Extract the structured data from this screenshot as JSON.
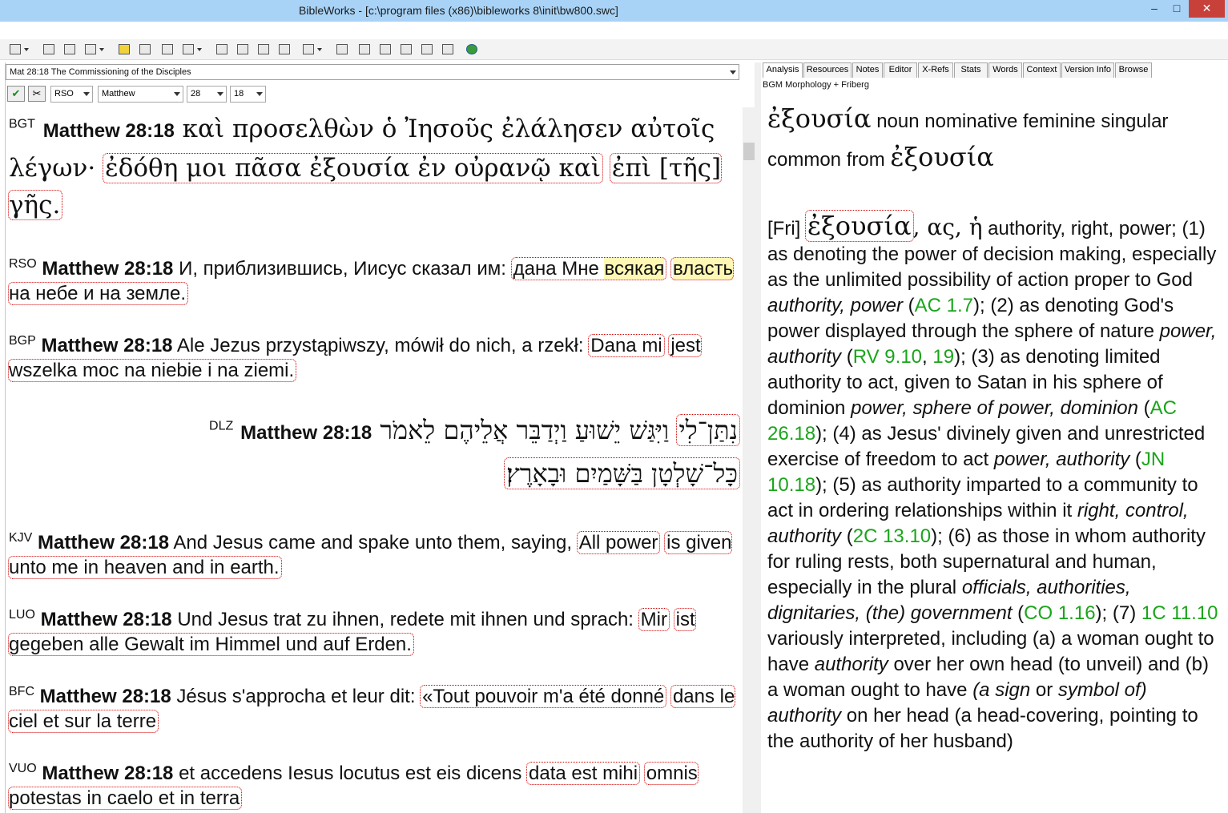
{
  "window": {
    "title": "BibleWorks - [c:\\program files (x86)\\bibleworks 8\\init\\bw800.swc]",
    "minimize": "–",
    "maximize": "□",
    "close": "✕"
  },
  "toolbar": {
    "icons": [
      "bookmark-icon",
      "new-window-icon",
      "tools-icon",
      "search-icon",
      "highlight-icon",
      "window-icon",
      "arrows-icon",
      "grid-icon",
      "list-icon",
      "copy-icon",
      "edit-icon",
      "print-icon",
      "search-options-icon",
      "layout-icon",
      "chart-icon",
      "person-icon",
      "plus-verse-icon",
      "ev-icon",
      "ew-icon",
      "globe-icon"
    ]
  },
  "left": {
    "verse_bar": "Mat 28:18 The Commissioning of the Disciples",
    "version_combo": "RSO",
    "book_combo": "Matthew",
    "chapter_combo": "28",
    "verse_combo": "18",
    "verses": [
      {
        "version": "BGT",
        "ref": "Matthew 28:18",
        "text_a": "καὶ προσελθὼν ὁ Ἰησοῦς ἐλάλησεν αὐτοῖς λέγων·",
        "text_b": "ἐδόθη μοι πᾶσα ἐξουσία ἐν οὐρανῷ καὶ",
        "text_c": "ἐπὶ [τῆς] γῆς."
      },
      {
        "version": "RSO",
        "ref": "Matthew 28:18",
        "text_a": "И, приблизившись, Иисус сказал им:",
        "text_b": "дана Мне",
        "text_y": "всякая",
        "text_c": "власть",
        "text_d": "на небе и на земле."
      },
      {
        "version": "BGP",
        "ref": "Matthew 28:18",
        "text_a": "Ale Jezus przystąpiwszy, mówił do nich, a rzekł:",
        "text_b": "Dana mi",
        "text_c": "jest wszelka moc na niebie i na ziemi."
      },
      {
        "version": "DLZ",
        "ref": "Matthew 28:18",
        "text_a": "וַיִּגַּשׁ יֵשׁוּעַ וַיְדַבֵּר אֲלֵיהֶם לֵאמֹר",
        "text_b": "נִתַּן־לִי",
        "text_c": "כָּל־שָׁלְטָן בַּשָּׁמַיִם וּבָאָרֶץ׃"
      },
      {
        "version": "KJV",
        "ref": "Matthew 28:18",
        "text_a": "And Jesus came and spake unto them, saying,",
        "text_b": "All power",
        "text_c": "is given unto me in heaven and in earth."
      },
      {
        "version": "LUO",
        "ref": "Matthew 28:18",
        "text_a": "Und Jesus trat zu ihnen, redete mit ihnen und sprach:",
        "text_b": "Mir",
        "text_c": "ist gegeben alle Gewalt im Himmel und auf Erden."
      },
      {
        "version": "BFC",
        "ref": "Matthew 28:18",
        "text_a": "Jésus s'approcha et leur dit:",
        "text_b": "«Tout pouvoir m'a été donné",
        "text_c": "dans le ciel et sur la terre"
      },
      {
        "version": "VUO",
        "ref": "Matthew 28:18",
        "text_a": "et accedens Iesus locutus est eis dicens",
        "text_b": "data est mihi",
        "text_c": "omnis potestas in caelo et in terra"
      }
    ]
  },
  "right": {
    "tabs": [
      "Analysis",
      "Resources",
      "Notes",
      "Editor",
      "X-Refs",
      "Stats",
      "Words",
      "Context",
      "Version Info",
      "Browse"
    ],
    "morph_label": "BGM Morphology + Friberg",
    "parse_word": "ἐξουσία",
    "parse_text": "noun nominative feminine singular common from",
    "parse_lemma": "ἐξουσία",
    "lex_src": "[Fri]",
    "lex_word": "ἐξουσία",
    "lex_forms": ", ας, ἡ",
    "p1": "authority, right, power; (1) as denoting the power of decision making, especially as the unlimited possibility of action proper to God",
    "i1": "authority, power",
    "r1": "AC 1.7",
    "p2": "); (2) as denoting God's power displayed through the sphere of nature",
    "i2": "power, authority",
    "r2": "RV 9.10",
    "r2b": "19",
    "p3": "); (3) as denoting limited authority to act, given to Satan in his sphere of dominion",
    "i3": "power, sphere of power, dominion",
    "r3": "AC 26.18",
    "p4": "); (4) as Jesus' divinely given and unrestricted exercise of freedom to act",
    "i4": "power, authority",
    "r4": "JN 10.18",
    "p5": "); (5) as authority imparted to a community to act in ordering relationships within it",
    "i5": "right, control, authority",
    "r5": "2C 13.10",
    "p6": "); (6) as those in whom authority for ruling rests, both supernatural and human, especially in the plural",
    "i6": "officials, authorities, dignitaries, (the) government",
    "r6": "CO 1.16",
    "p7": "); (7)",
    "r7": "1C 11.10",
    "p8": "variously interpreted, including (a) a woman ought to have",
    "i8": "authority",
    "p9": "over her own head (to unveil) and (b) a woman ought to have",
    "i9": "(a sign",
    "p10": "or",
    "i10": "symbol of) authority",
    "p11": "on her head (a head-covering, pointing to the authority of her husband)"
  }
}
